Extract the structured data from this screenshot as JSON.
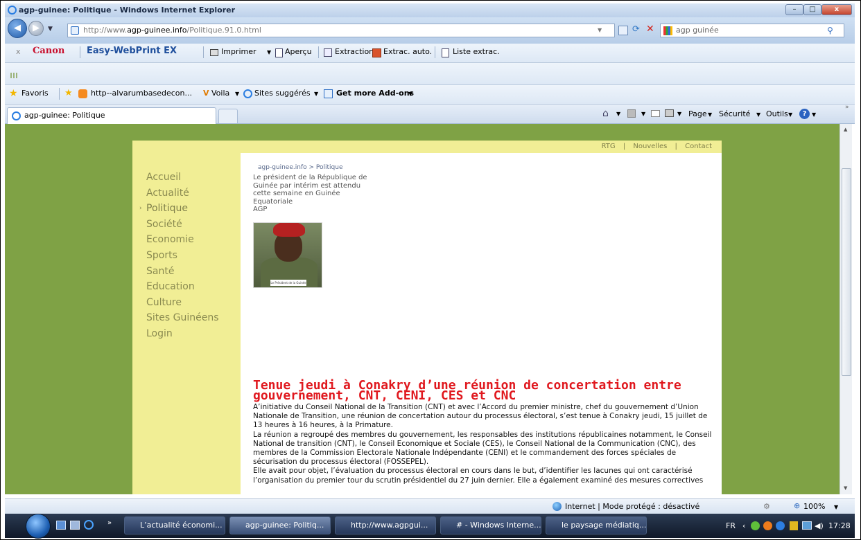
{
  "window": {
    "title": "agp-guinee: Politique - Windows Internet Explorer",
    "minimize": "–",
    "maximize": "□",
    "close": "x"
  },
  "address": {
    "url_prefix": "http://www.",
    "url_domain": "agp-guinee.info",
    "url_path": "/Politique.91.0.html",
    "search_value": "agp guinée"
  },
  "canon_bar": {
    "close": "x",
    "brand": "Canon",
    "product": "Easy-WebPrint EX",
    "items": [
      "Imprimer",
      "Aperçu",
      "Extraction",
      "Extrac. auto.",
      "Liste extrac."
    ]
  },
  "favorites_bar": {
    "favoris": "Favoris",
    "items": [
      "http--alvarumbasedecon...",
      "Voila",
      "Sites suggérés",
      "Get more Add-ons"
    ]
  },
  "tabs": {
    "active": "agp-guinee: Politique"
  },
  "command_bar": {
    "items": [
      "Page",
      "Sécurité",
      "Outils"
    ]
  },
  "page": {
    "top_links": [
      "RTG",
      "Nouvelles",
      "Contact"
    ],
    "top_separator": "|",
    "menu": [
      "Accueil",
      "Actualité",
      "Politique",
      "Société",
      "Economie",
      "Sports",
      "Santé",
      "Education",
      "Culture",
      "Sites Guinéens",
      "Login"
    ],
    "active_menu_index": 2,
    "breadcrumb": "agp-guinee.info > Politique",
    "lead": "Le président de la République de Guinée par intérim est attendu cette semaine en Guinée Equatoriale",
    "lead_source": "AGP",
    "photo_caption": "Le Président de la Guinée",
    "headline": "Tenue jeudi à Conakry d’une réunion de concertation entre gouvernement, CNT, CENI, CES et CNC",
    "paragraphs": [
      "A’initiative du Conseil National de la Transition (CNT) et avec l’Accord du premier ministre, chef du gouvernement d’Union Nationale de Transition, une réunion de concertation autour du processus électoral, s’est tenue à Conakry jeudi, 15 juillet de 13 heures à 16 heures, à la Primature.",
      "La réunion a regroupé des membres du gouvernement, les responsables des institutions républicaines notamment, le Conseil National de transition (CNT), le Conseil Economique et Sociale (CES), le Conseil National de la Communication (CNC), des membres de la Commission Electorale Nationale Indépendante (CENI) et le commandement des forces spéciales de sécurisation du processus électoral (FOSSEPEL).",
      "Elle avait pour objet, l’évaluation du processus électoral en cours dans le but, d’identifier les lacunes qui ont caractérisé l’organisation du premier tour du scrutin présidentiel du 27 juin dernier. Elle a également examiné des mesures correctives"
    ]
  },
  "status_bar": {
    "zone": "Internet | Mode protégé : désactivé",
    "zoom": "100%"
  },
  "taskbar": {
    "tasks": [
      "L’actualité économi...",
      "agp-guinee: Politiq...",
      "http://www.agpgui...",
      "# - Windows Interne...",
      "le paysage médiatiq..."
    ],
    "active_index": 1,
    "language": "FR",
    "clock": "17:28"
  },
  "colors": {
    "page_green": "#7fa245",
    "page_yellow": "#f1ee95",
    "headline_red": "#e0181e",
    "menu_text": "#8a8a50"
  }
}
